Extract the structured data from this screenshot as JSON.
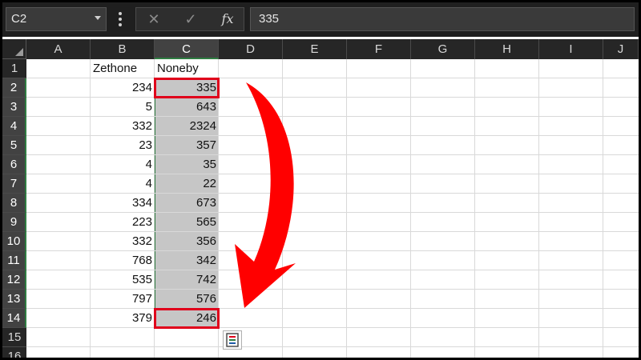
{
  "formula_bar": {
    "name_box": "C2",
    "cancel_glyph": "✕",
    "enter_glyph": "✓",
    "fx_label": "fx",
    "formula_value": "335"
  },
  "columns": [
    "A",
    "B",
    "C",
    "D",
    "E",
    "F",
    "G",
    "H",
    "I",
    "J"
  ],
  "selected_column": "C",
  "rows": [
    "1",
    "2",
    "3",
    "4",
    "5",
    "6",
    "7",
    "8",
    "9",
    "10",
    "11",
    "12",
    "13",
    "14",
    "15",
    "16"
  ],
  "selected_rows": [
    "2",
    "3",
    "4",
    "5",
    "6",
    "7",
    "8",
    "9",
    "10",
    "11",
    "12",
    "13",
    "14"
  ],
  "headers": {
    "B1": "Zethone",
    "C1": "Noneby"
  },
  "column_b": [
    "234",
    "5",
    "332",
    "23",
    "4",
    "4",
    "334",
    "223",
    "332",
    "768",
    "535",
    "797",
    "379"
  ],
  "column_c": [
    "335",
    "643",
    "2324",
    "357",
    "35",
    "22",
    "673",
    "565",
    "356",
    "342",
    "742",
    "576",
    "246"
  ],
  "icons": {
    "name_box_dropdown": "chevron-down-icon",
    "quick_analysis": "quick-analysis-icon",
    "fill_arrow": "curved-down-arrow-icon"
  },
  "colors": {
    "selection_fill": "#c6c6c6",
    "highlight_red": "#e0001b",
    "excel_green": "#2f7d42"
  }
}
